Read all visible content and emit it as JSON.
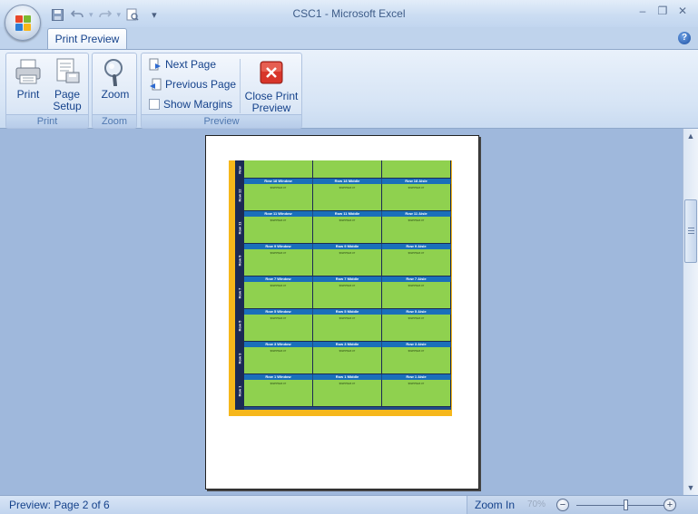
{
  "window": {
    "title": "CSC1 - Microsoft Excel",
    "minimize_glyph": "–",
    "restore_glyph": "❐",
    "close_glyph": "✕"
  },
  "qat": {
    "save_icon": "save-icon",
    "undo_icon": "undo-icon",
    "redo_icon": "redo-icon",
    "print_preview_icon": "print-preview-icon",
    "customize_glyph": "▾"
  },
  "tabs": [
    {
      "label": "Print Preview",
      "active": true
    }
  ],
  "help_glyph": "?",
  "ribbon": {
    "groups": {
      "print": "Print",
      "zoom": "Zoom",
      "preview": "Preview"
    },
    "buttons": {
      "print": "Print",
      "page_setup_line1": "Page",
      "page_setup_line2": "Setup",
      "zoom": "Zoom",
      "next_page": "Next Page",
      "previous_page": "Previous Page",
      "show_margins": "Show Margins",
      "close_line1": "Close Print",
      "close_line2": "Preview"
    }
  },
  "preview": {
    "row_labels": [
      "Row",
      "Row 12",
      "Row 11",
      "Row 9",
      "Row 7",
      "Row 5",
      "Row 3",
      "Row 1"
    ],
    "headers": [
      [
        "Row 18 Window",
        "Row 18 Middle",
        "Row 18 Aisle"
      ],
      [
        "Row 11 Window",
        "Row 11 Middle",
        "Row 11 Aisle"
      ],
      [
        "Row 9 Window",
        "Row 9 Middle",
        "Row 9 Aisle"
      ],
      [
        "Row 7 Window",
        "Row 7 Middle",
        "Row 7 Aisle"
      ],
      [
        "Row 5 Window",
        "Row 5 Middle",
        "Row 5 Aisle"
      ],
      [
        "Row 3 Window",
        "Row 3 Middle",
        "Row 3 Aisle"
      ],
      [
        "Row 1 Window",
        "Row 1 Middle",
        "Row 1 Aisle"
      ]
    ],
    "cell_subtext": "$WPP$18.07"
  },
  "status": {
    "page_text": "Preview: Page 2 of 6",
    "zoom_in_label": "Zoom In",
    "zoom_percent": "70%",
    "zoom_level_fraction": 0.5
  },
  "colors": {
    "accent": "#15428b",
    "cell_green": "#8fd14f",
    "header_blue": "#1a6fba",
    "label_navy": "#1b2a55",
    "border_orange": "#f6b71b"
  }
}
